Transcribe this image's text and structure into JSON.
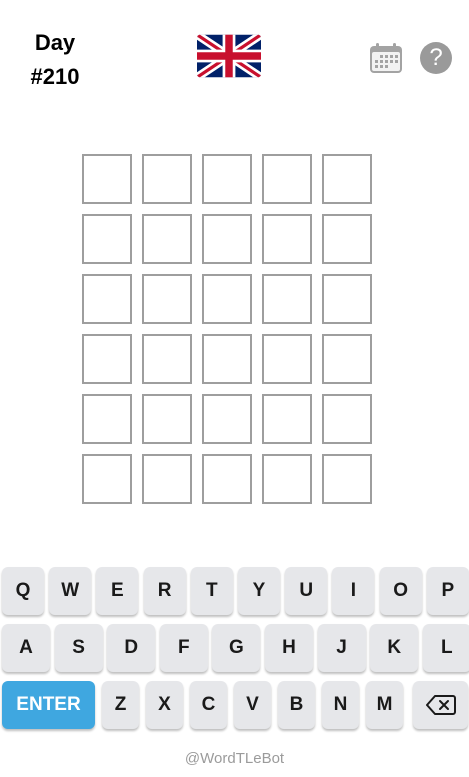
{
  "header": {
    "day_label": "Day",
    "day_number": "#210",
    "flag_icon": "uk-flag-icon",
    "calendar_icon": "calendar-icon",
    "help_symbol": "?"
  },
  "board": {
    "rows": 6,
    "cols": 5
  },
  "keyboard": {
    "row1": [
      "Q",
      "W",
      "E",
      "R",
      "T",
      "Y",
      "U",
      "I",
      "O",
      "P"
    ],
    "row2": [
      "A",
      "S",
      "D",
      "F",
      "G",
      "H",
      "J",
      "K",
      "L"
    ],
    "row3": [
      "ENTER",
      "Z",
      "X",
      "C",
      "V",
      "B",
      "N",
      "M",
      "BACKSPACE"
    ],
    "backspace_icon": "backspace-icon"
  },
  "colors": {
    "enter_key": "#3fa7e0",
    "key_bg": "#e6e7ea",
    "tile_border": "#9e9e9e",
    "help_bg": "#9a9a9a"
  },
  "footer": {
    "credit": "@WordTLeBot"
  }
}
